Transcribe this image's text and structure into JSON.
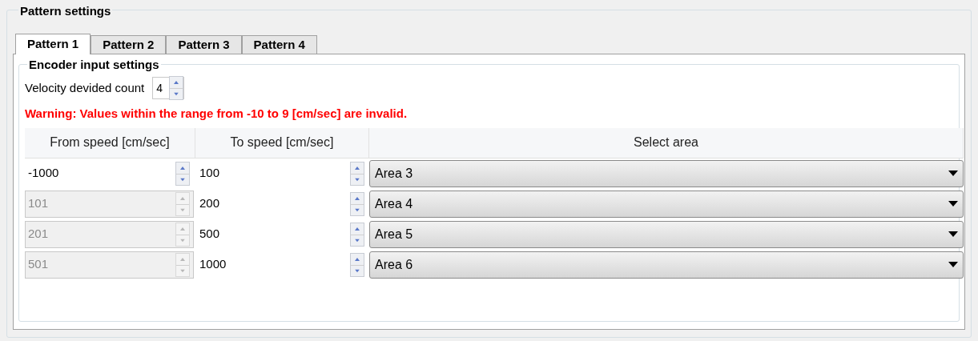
{
  "group_title": "Pattern settings",
  "tabs": [
    {
      "label": "Pattern 1",
      "selected": true
    },
    {
      "label": "Pattern 2",
      "selected": false
    },
    {
      "label": "Pattern 3",
      "selected": false
    },
    {
      "label": "Pattern 4",
      "selected": false
    }
  ],
  "encoder_group": {
    "title": "Encoder input settings",
    "velocity_label": "Velocity devided count",
    "velocity_value": "4",
    "warning": "Warning: Values within the range from -10 to 9 [cm/sec] are invalid."
  },
  "table": {
    "columns": [
      "From speed [cm/sec]",
      "To speed [cm/sec]",
      "Select area"
    ],
    "rows": [
      {
        "from": "-1000",
        "from_disabled": false,
        "to": "100",
        "area": "Area 3"
      },
      {
        "from": "101",
        "from_disabled": true,
        "to": "200",
        "area": "Area 4"
      },
      {
        "from": "201",
        "from_disabled": true,
        "to": "500",
        "area": "Area 5"
      },
      {
        "from": "501",
        "from_disabled": true,
        "to": "1000",
        "area": "Area 6"
      }
    ]
  }
}
